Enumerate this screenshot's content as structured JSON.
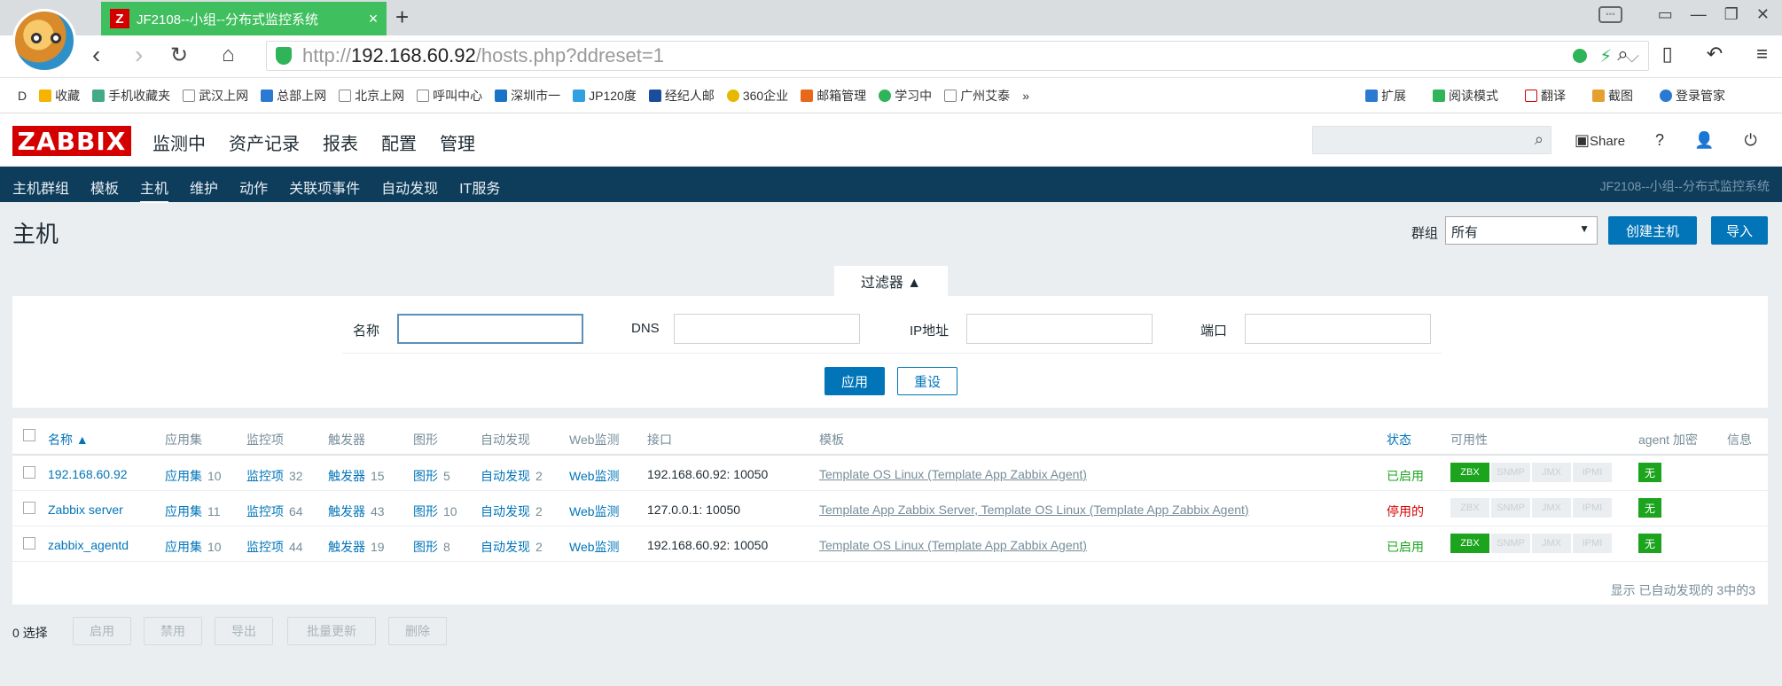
{
  "browser": {
    "tab_title": "JF2108--小组--分布式监控系统",
    "url_prefix": "http://",
    "url_host": "192.168.60.92",
    "url_path": "/hosts.php?ddreset=1",
    "bookmarks": [
      "收藏",
      "手机收藏夹",
      "武汉上网",
      "总部上网",
      "北京上网",
      "呼叫中心",
      "深圳市一",
      "JP120度",
      "经纪人邮",
      "360企业",
      "邮箱管理",
      "学习中",
      "广州艾泰"
    ],
    "bookmarks_right": [
      "扩展",
      "阅读模式",
      "翻译",
      "截图",
      "登录管家"
    ]
  },
  "zabbix": {
    "logo": "ZABBIX",
    "main_menu": [
      "监测中",
      "资产记录",
      "报表",
      "配置",
      "管理"
    ],
    "active_main": "配置",
    "share_label": "Share",
    "sub_menu": [
      "主机群组",
      "模板",
      "主机",
      "维护",
      "动作",
      "关联项事件",
      "自动发现",
      "IT服务"
    ],
    "active_sub": "主机",
    "sub_right": "JF2108--小组--分布式监控系统",
    "page_title": "主机",
    "group_label": "群组",
    "group_value": "所有",
    "create_host": "创建主机",
    "import": "导入",
    "filter": {
      "tab_label": "过滤器 ▲",
      "name_label": "名称",
      "dns_label": "DNS",
      "ip_label": "IP地址",
      "port_label": "端口",
      "apply": "应用",
      "reset": "重设"
    },
    "table": {
      "headers": {
        "name": "名称 ▲",
        "apps": "应用集",
        "items": "监控项",
        "triggers": "触发器",
        "graphs": "图形",
        "discovery": "自动发现",
        "web": "Web监测",
        "interface": "接口",
        "templates": "模板",
        "status": "状态",
        "availability": "可用性",
        "agent_enc": "agent 加密",
        "info": "信息"
      },
      "rows": [
        {
          "name": "192.168.60.92",
          "apps": "应用集",
          "apps_n": "10",
          "items": "监控项",
          "items_n": "32",
          "triggers": "触发器",
          "triggers_n": "15",
          "graphs": "图形",
          "graphs_n": "5",
          "discovery": "自动发现",
          "discovery_n": "2",
          "web": "Web监测",
          "interface": "192.168.60.92: 10050",
          "templates": "Template OS Linux (Template App Zabbix Agent)",
          "status": "已启用",
          "zbx_on": true,
          "enc": "无"
        },
        {
          "name": "Zabbix server",
          "apps": "应用集",
          "apps_n": "11",
          "items": "监控项",
          "items_n": "64",
          "triggers": "触发器",
          "triggers_n": "43",
          "graphs": "图形",
          "graphs_n": "10",
          "discovery": "自动发现",
          "discovery_n": "2",
          "web": "Web监测",
          "interface": "127.0.0.1: 10050",
          "templates": "Template App Zabbix Server, Template OS Linux (Template App Zabbix Agent)",
          "status": "停用的",
          "zbx_on": false,
          "enc": "无"
        },
        {
          "name": "zabbix_agentd",
          "apps": "应用集",
          "apps_n": "10",
          "items": "监控项",
          "items_n": "44",
          "triggers": "触发器",
          "triggers_n": "19",
          "graphs": "图形",
          "graphs_n": "8",
          "discovery": "自动发现",
          "discovery_n": "2",
          "web": "Web监测",
          "interface": "192.168.60.92: 10050",
          "templates": "Template OS Linux (Template App Zabbix Agent)",
          "status": "已启用",
          "zbx_on": true,
          "enc": "无"
        }
      ],
      "avail_labels": [
        "ZBX",
        "SNMP",
        "JMX",
        "IPMI"
      ],
      "footer": "显示 已自动发现的 3中的3"
    },
    "selected_count": "0 选择",
    "bottom_buttons": [
      "启用",
      "禁用",
      "导出",
      "批量更新",
      "删除"
    ]
  }
}
